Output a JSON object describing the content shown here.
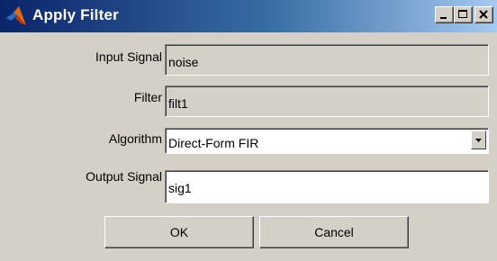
{
  "window": {
    "title": "Apply Filter",
    "icon": "matlab-logo-icon",
    "controls": [
      "minimize-icon",
      "maximize-icon",
      "close-icon"
    ]
  },
  "form": {
    "input_signal": {
      "label": "Input Signal",
      "value": "noise"
    },
    "filter": {
      "label": "Filter",
      "value": "filt1"
    },
    "algorithm": {
      "label": "Algorithm",
      "value": "Direct-Form FIR"
    },
    "output_signal": {
      "label": "Output Signal",
      "value": "sig1"
    }
  },
  "buttons": {
    "ok": "OK",
    "cancel": "Cancel"
  }
}
